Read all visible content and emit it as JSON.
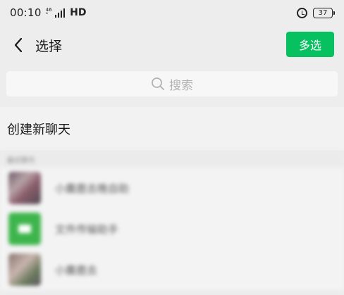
{
  "status_bar": {
    "time": "00:10",
    "network_top": "46",
    "network_bottom": "°",
    "hd": "HD",
    "battery": "37"
  },
  "nav": {
    "title": "选择",
    "multi_select_label": "多选"
  },
  "search": {
    "placeholder": "搜索"
  },
  "new_chat_label": "创建新聊天",
  "recent": {
    "header": "最近聊天",
    "items": [
      {
        "name": "小麋鹿去晚自助",
        "avatar": "photo"
      },
      {
        "name": "文件传输助手",
        "avatar": "green"
      },
      {
        "name": "小麋鹿去",
        "avatar": "photo2"
      }
    ]
  },
  "colors": {
    "accent": "#07c160",
    "background": "#ededed"
  },
  "icons": {
    "back": "chevron-left-icon",
    "search": "search-icon",
    "alarm": "alarm-icon",
    "battery": "battery-icon",
    "signal": "signal-icon"
  }
}
